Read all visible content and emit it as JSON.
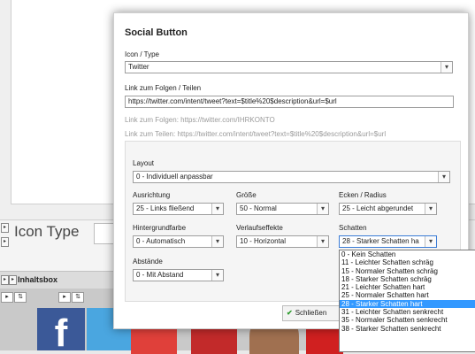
{
  "background": {
    "icon_type_label": "Icon Type",
    "inhaltsbox_label": "Inhaltsbox",
    "facebook_letter": "f"
  },
  "modal": {
    "title": "Social Button",
    "icon_type": {
      "label": "Icon / Type",
      "value": "Twitter"
    },
    "link": {
      "label": "Link zum Folgen / Teilen",
      "value": "https://twitter.com/intent/tweet?text=$title%20$description&url=$url",
      "hint_follow": "Link zum Folgen: https://twitter.com/IHRKONTO",
      "hint_share": "Link zum Teilen: https://twitter.com/intent/tweet?text=$title%20$description&url=$url"
    },
    "layout": {
      "label": "Layout",
      "value": "0 - Individuell anpassbar"
    },
    "ausrichtung": {
      "label": "Ausrichtung",
      "value": "25 - Links fließend"
    },
    "groesse": {
      "label": "Größe",
      "value": "50 - Normal"
    },
    "ecken": {
      "label": "Ecken / Radius",
      "value": "25 - Leicht abgerundet"
    },
    "hintergrundfarbe": {
      "label": "Hintergrundfarbe",
      "value": "0 - Automatisch"
    },
    "verlaufseffekte": {
      "label": "Verlaufseffekte",
      "value": "10 - Horizontal"
    },
    "schatten": {
      "label": "Schatten",
      "value": "28 - Starker Schatten ha"
    },
    "abstaende": {
      "label": "Abstände",
      "value": "0 - Mit Abstand"
    },
    "close_button": "Schließen"
  },
  "dropdown": {
    "selected_index": 6,
    "options": [
      "0 - Kein Schatten",
      "11 - Leichter Schatten schräg",
      "15 - Normaler Schatten schräg",
      "18 - Starker Schatten schräg",
      "21 - Leichter Schatten hart",
      "25 - Normaler Schatten hart",
      "28 - Starker Schatten hart",
      "31 - Leichter Schatten senkrecht",
      "35 - Normaler Schatten senkrecht",
      "38 - Starker Schatten senkrecht"
    ]
  }
}
